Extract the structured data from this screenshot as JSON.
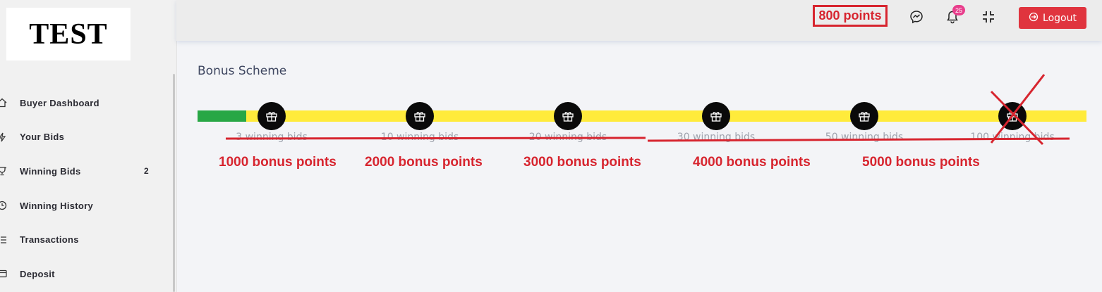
{
  "logo": {
    "text": "TEST"
  },
  "sidebar": {
    "items": [
      {
        "label": "Buyer Dashboard",
        "icon": "home-icon",
        "badge": ""
      },
      {
        "label": "Your Bids",
        "icon": "bolt-icon",
        "badge": ""
      },
      {
        "label": "Winning Bids",
        "icon": "trophy-icon",
        "badge": "2"
      },
      {
        "label": "Winning History",
        "icon": "clock-icon",
        "badge": ""
      },
      {
        "label": "Transactions",
        "icon": "list-icon",
        "badge": ""
      },
      {
        "label": "Deposit",
        "icon": "card-icon",
        "badge": ""
      }
    ]
  },
  "header": {
    "points_label": "800 points",
    "notification_count": "25",
    "logout_label": "Logout",
    "icons": [
      "messenger-icon",
      "bell-icon",
      "compress-icon",
      "logout-icon"
    ]
  },
  "main": {
    "title": "Bonus Scheme",
    "progress_fraction": 0.055,
    "steps": [
      {
        "label": "3 winning bids",
        "bonus": "1000 bonus points"
      },
      {
        "label": "10 winning bids",
        "bonus": "2000 bonus points"
      },
      {
        "label": "20 winning bids",
        "bonus": "3000 bonus points"
      },
      {
        "label": "30 winning bids",
        "bonus": "4000 bonus points"
      },
      {
        "label": "50 winning bids",
        "bonus": "5000 bonus points"
      },
      {
        "label": "100 winning bids",
        "bonus": ""
      }
    ]
  },
  "colors": {
    "accent_red": "#d7252f",
    "progress_green": "#28a745",
    "track_yellow": "#ffeb3b",
    "badge_pink": "#e83e8c"
  }
}
